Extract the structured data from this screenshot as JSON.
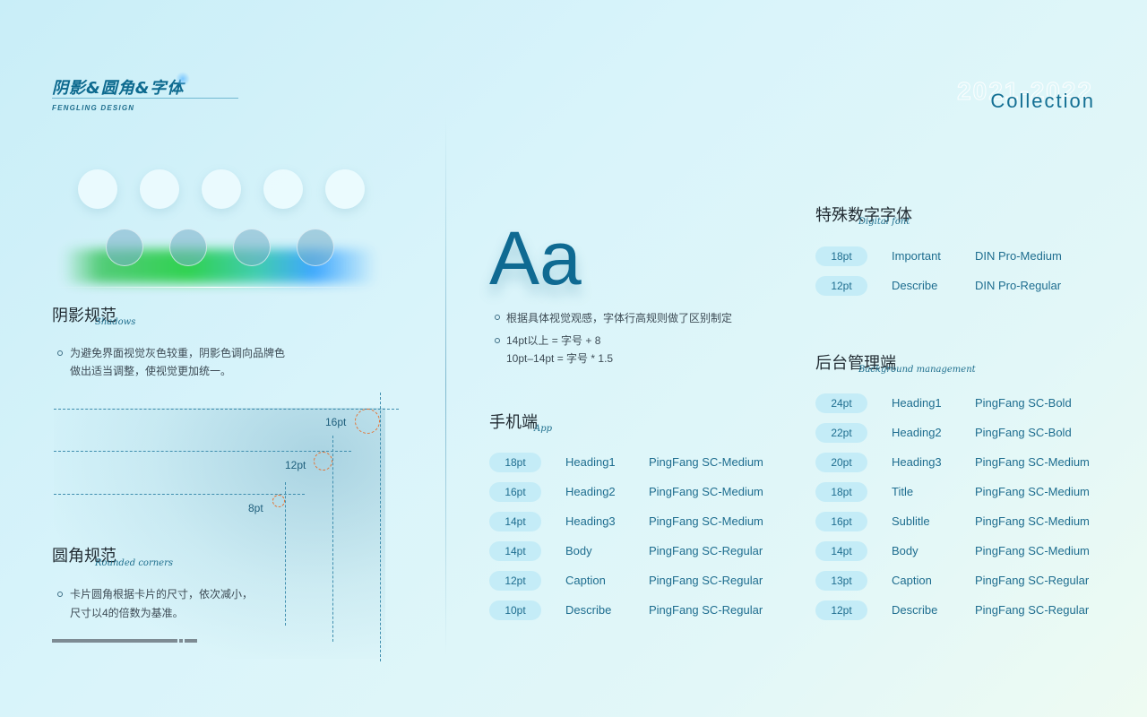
{
  "header": {
    "title": "阴影&圆角&字体",
    "subtitle": "FENGLING DESIGN",
    "year": "2021-2022",
    "collection": "Collection"
  },
  "shadow": {
    "title": "阴影规范",
    "script": "Shadows",
    "lines": [
      "为避免界面视觉灰色较重，阴影色调向品牌色",
      "做出适当调整，使视觉更加统一。"
    ]
  },
  "corner": {
    "title": "圆角规范",
    "script": "Rounded corners",
    "labels": [
      "16pt",
      "12pt",
      "8pt"
    ],
    "lines": [
      "卡片圆角根据卡片的尺寸，依次减小，",
      "尺寸以4的倍数为基准。"
    ]
  },
  "typography": {
    "sample": "Aa",
    "rule1": "根据具体视觉观感，字体行高规则做了区别制定",
    "rule2a": "14pt以上 = 字号 + 8",
    "rule2b": "10pt–14pt = 字号 * 1.5"
  },
  "app": {
    "title": "手机端",
    "script": "App",
    "rows": [
      {
        "size": "18pt",
        "role": "Heading1",
        "font": "PingFang SC-Medium"
      },
      {
        "size": "16pt",
        "role": "Heading2",
        "font": "PingFang SC-Medium"
      },
      {
        "size": "14pt",
        "role": "Heading3",
        "font": "PingFang SC-Medium"
      },
      {
        "size": "14pt",
        "role": "Body",
        "font": "PingFang SC-Regular"
      },
      {
        "size": "12pt",
        "role": "Caption",
        "font": "PingFang SC-Regular"
      },
      {
        "size": "10pt",
        "role": "Describe",
        "font": "PingFang SC-Regular"
      }
    ]
  },
  "digital": {
    "title": "特殊数字字体",
    "script": "Digital font",
    "rows": [
      {
        "size": "18pt",
        "role": "Important",
        "font": "DIN Pro-Medium"
      },
      {
        "size": "12pt",
        "role": "Describe",
        "font": "DIN Pro-Regular"
      }
    ]
  },
  "admin": {
    "title": "后台管理端",
    "script": "Background management",
    "rows": [
      {
        "size": "24pt",
        "role": "Heading1",
        "font": "PingFang SC-Bold"
      },
      {
        "size": "22pt",
        "role": "Heading2",
        "font": "PingFang SC-Bold"
      },
      {
        "size": "20pt",
        "role": "Heading3",
        "font": "PingFang SC-Medium"
      },
      {
        "size": "18pt",
        "role": "Title",
        "font": "PingFang SC-Medium"
      },
      {
        "size": "16pt",
        "role": "Sublitle",
        "font": "PingFang SC-Medium"
      },
      {
        "size": "14pt",
        "role": "Body",
        "font": "PingFang SC-Medium"
      },
      {
        "size": "13pt",
        "role": "Caption",
        "font": "PingFang SC-Regular"
      },
      {
        "size": "12pt",
        "role": "Describe",
        "font": "PingFang SC-Regular"
      }
    ]
  }
}
